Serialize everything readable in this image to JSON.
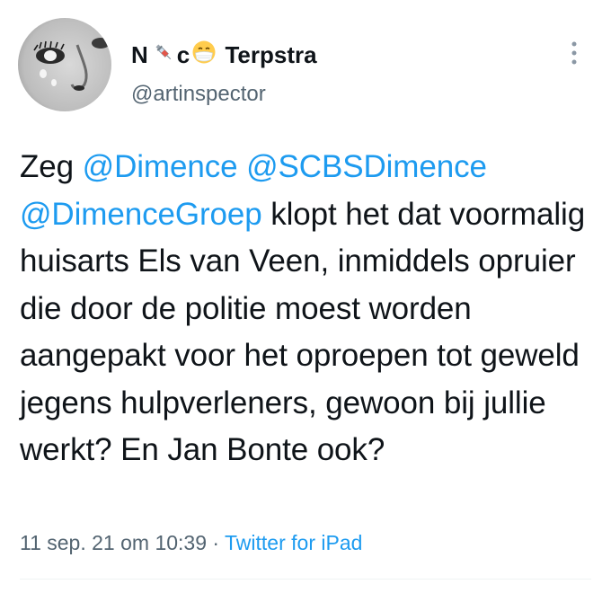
{
  "author": {
    "name_part1": "N",
    "syringe_icon": "syringe-icon",
    "name_part2": "c",
    "mask_icon": "face-with-medical-mask-icon",
    "name_part3": " Terpstra",
    "handle": "@artinspector"
  },
  "tweet": {
    "text_1": "Zeg ",
    "mention_1": "@Dimence",
    "text_2": " ",
    "mention_2": "@SCBSDimence",
    "text_3": " ",
    "mention_3": "@DimenceGroep",
    "text_4": " klopt het dat voormalig huisarts Els van Veen, inmiddels opruier die door de politie moest worden aangepakt voor het oproepen tot geweld jegens hulpverleners, gewoon bij jullie werkt? En Jan Bonte ook?",
    "timestamp": "11 sep. 21 om 10:39",
    "separator": " · ",
    "source": "Twitter for iPad"
  },
  "colors": {
    "link": "#1d9bf0",
    "secondary": "#536471",
    "text": "#0f1419"
  }
}
